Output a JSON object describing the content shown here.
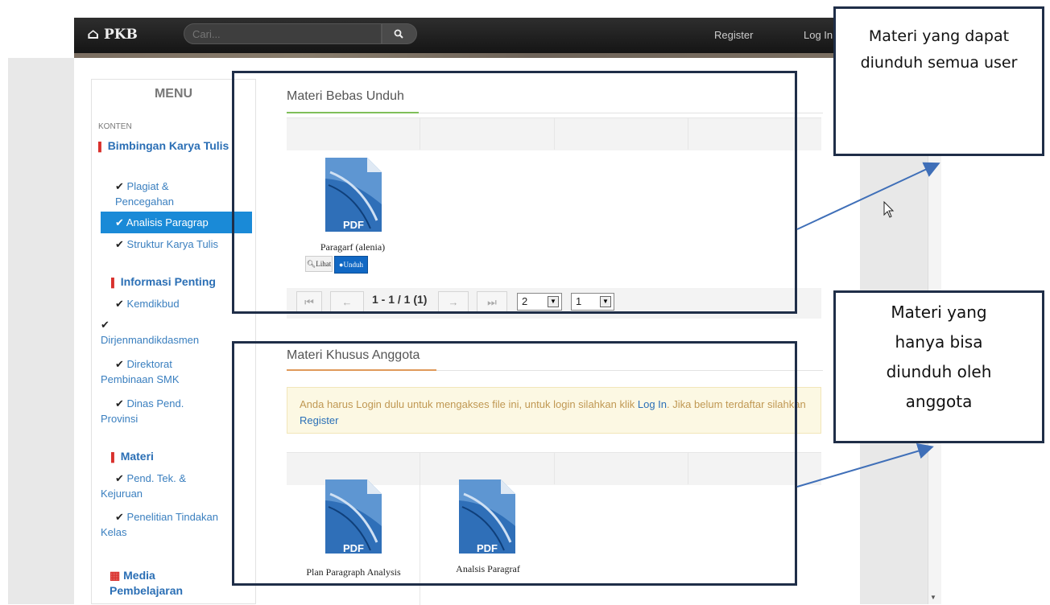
{
  "nav": {
    "brand": "PKB",
    "search_placeholder": "Cari...",
    "register": "Register",
    "login": "Log In"
  },
  "menu": {
    "title": "MENU",
    "section": "KONTEN",
    "groups": [
      {
        "title": "Bimbingan Karya Tulis",
        "icon": "bookmark-icon",
        "items": [
          "Plagiat & Pencegahan",
          "Analisis Paragrap",
          "Struktur Karya Tulis"
        ]
      },
      {
        "title": "Informasi Penting",
        "icon": "bookmark-icon",
        "items": [
          "Kemdikbud",
          "Dirjenmandikdasmen",
          "Direktorat Pembinaan SMK",
          "Dinas Pend. Provinsi"
        ]
      },
      {
        "title": "Materi",
        "icon": "bookmark-icon",
        "items": [
          "Pend. Tek. & Kejuruan",
          "Penelitian Tindakan Kelas"
        ]
      },
      {
        "title": "Media Pembelajaran",
        "icon": "film-icon",
        "items": []
      }
    ],
    "active_item": "Analisis Paragrap"
  },
  "free": {
    "title": "Materi Bebas Unduh",
    "files": [
      {
        "type": "PDF",
        "name": "Paragarf (alenia)",
        "view_label": "Lihat",
        "download_label": "Unduh"
      }
    ],
    "pager": {
      "range": "1 - 1 / 1 (1)",
      "page_size": "2",
      "page": "1"
    }
  },
  "members": {
    "title": "Materi Khusus Anggota",
    "alert": {
      "text1": "Anda harus Login dulu untuk mengakses file ini, untuk login silahkan klik ",
      "login_link": "Log In",
      "text2": ". Jika belum terdaftar silahkan ",
      "register_link": "Register"
    },
    "files": [
      {
        "type": "PDF",
        "name": "Plan Paragraph Analysis"
      },
      {
        "type": "PDF",
        "name": "Analsis Paragraf"
      }
    ]
  },
  "annotations": {
    "top": "Materi yang dapat diunduh semua user",
    "bottom": "Materi yang hanya bisa diunduh oleh anggota"
  },
  "colors": {
    "annotation": "#1f2e48",
    "arrow": "#3f6fb8",
    "active": "#1a8ad7",
    "link": "#2b6fb5"
  }
}
